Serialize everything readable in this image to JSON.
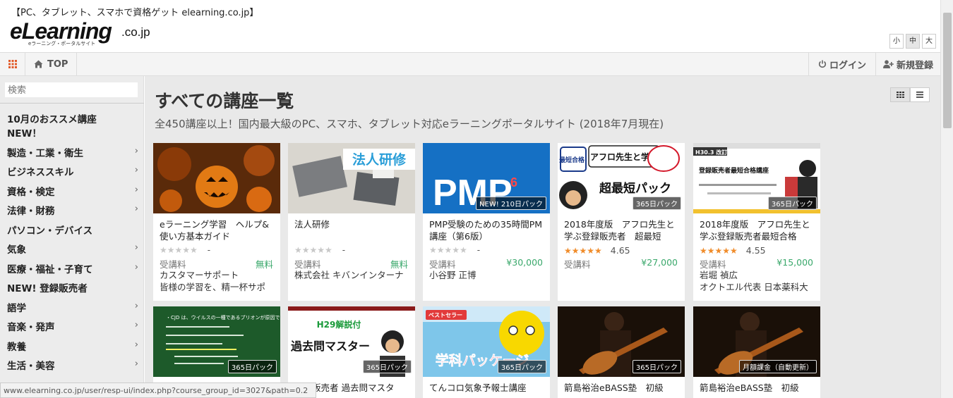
{
  "header": {
    "tagline": "【PC、タブレット、スマホで資格ゲット elearning.co.jp】",
    "logo_main": "eLearning",
    "logo_domain": ".co.jp",
    "logo_sub": "eラーニング・ポータルサイト",
    "font_sizes": [
      "小",
      "中",
      "大"
    ],
    "font_size_selected": "中"
  },
  "nav": {
    "top_label": "TOP",
    "login_label": "ログイン",
    "register_label": "新規登録"
  },
  "sidebar": {
    "search_placeholder": "検索",
    "items": [
      {
        "label": "10月のおススメ講座",
        "chevron": false
      },
      {
        "label": "NEW！",
        "chevron": false
      },
      {
        "label": "製造・工業・衛生",
        "chevron": true
      },
      {
        "label": "ビジネススキル",
        "chevron": true
      },
      {
        "label": "資格・検定",
        "chevron": true
      },
      {
        "label": "法律・財務",
        "chevron": true
      },
      {
        "label": "パソコン・デバイス",
        "chevron": false
      },
      {
        "label": "気象",
        "chevron": true
      },
      {
        "label": "医療・福祉・子育て",
        "chevron": true
      },
      {
        "label": "NEW! 登録販売者",
        "chevron": false
      },
      {
        "label": "語学",
        "chevron": true
      },
      {
        "label": "音楽・発声",
        "chevron": true
      },
      {
        "label": "教養",
        "chevron": true
      },
      {
        "label": "生活・美容",
        "chevron": true
      }
    ]
  },
  "main": {
    "title": "すべての講座一覧",
    "subtitle": "全450講座以上！国内最大級のPC、スマホ、タブレット対応eラーニングポータルサイト (2018年7月現在)"
  },
  "courses": [
    {
      "badge": "",
      "title": "eラーニング学習　ヘルプ&使い方基本ガイド",
      "stars": "★★★★★",
      "rated": false,
      "score": "-",
      "label": "受講料",
      "price": "無料",
      "instructor": "カスタマーサポート",
      "instructor2": "皆様の学習を、精一杯サポ",
      "thumb": "halloween"
    },
    {
      "badge": "",
      "title": "法人研修",
      "stars": "★★★★★",
      "rated": false,
      "score": "-",
      "label": "受講料",
      "price": "無料",
      "instructor": "株式会社 キバンインターナ",
      "instructor2": "",
      "thumb": "corporate",
      "thumb_text": "法人研修"
    },
    {
      "badge": "NEW! 210日パック",
      "title": "PMP受験のための35時間PM講座（第6版）",
      "stars": "★★★★★",
      "rated": false,
      "score": "-",
      "label": "受講料",
      "price": "¥30,000",
      "instructor": "小谷野 正博",
      "instructor2": "",
      "thumb": "pmp",
      "thumb_text": "PMP",
      "thumb_sup": "6"
    },
    {
      "badge": "365日パック",
      "title": "2018年度版　アフロ先生と学ぶ登録販売者　超最短",
      "stars": "★★★★★",
      "rated": true,
      "score": "4.65",
      "label": "受講料",
      "price": "¥27,000",
      "instructor": "",
      "instructor2": "",
      "thumb": "afro",
      "thumb_text": "超最短パック",
      "thumb_text2": "アフロ先生と学ぶ",
      "thumb_text3": "最短合格!"
    },
    {
      "badge": "365日パック",
      "title": "2018年度版　アフロ先生と学ぶ登録販売者最短合格",
      "stars": "★★★★★",
      "rated": true,
      "score": "4.55",
      "label": "受講料",
      "price": "¥15,000",
      "instructor": "岩堀 禎広",
      "instructor2": "オクトエル代表 日本薬科大",
      "thumb": "afro2",
      "thumb_text": "登録販売者最短合格講座",
      "thumb_text2": "H30.3 改訂版"
    },
    {
      "badge": "365日パック",
      "title": "",
      "thumb": "chalk",
      "thumb_text": "・CJD は、ウイルスの一種であるプリオンが原因である。"
    },
    {
      "badge": "365日パック",
      "title": "登録販売者 過去問マスタ",
      "thumb": "kakomon",
      "thumb_text": "過去問マスター",
      "thumb_text2": "H29解説付"
    },
    {
      "badge": "365日パック",
      "title": "てんコロ気象予報士講座",
      "thumb": "weather",
      "thumb_text": "学科パッケージ",
      "thumb_text2": "ベストセラー"
    },
    {
      "badge": "365日パック",
      "title": "箭島裕治eBASS塾　初級",
      "thumb": "bass"
    },
    {
      "badge": "月額課金（自動更新）",
      "title": "箭島裕治eBASS塾　初級",
      "thumb": "bass"
    }
  ],
  "statusbar": {
    "url": "www.elearning.co.jp/user/resp-ui/index.php?course_group_id=3027&path=0.2"
  }
}
